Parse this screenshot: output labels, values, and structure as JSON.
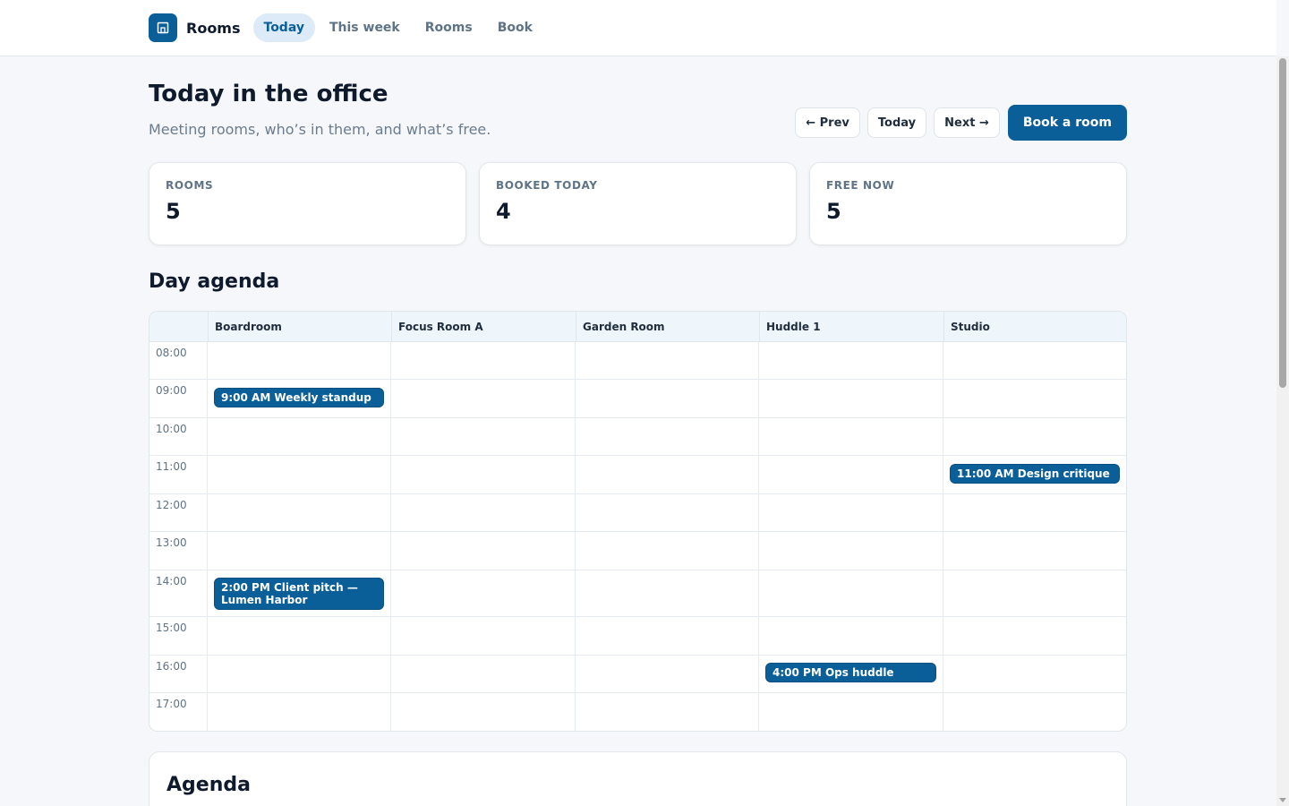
{
  "nav": {
    "brand": "Rooms",
    "items": [
      {
        "label": "Today",
        "active": true
      },
      {
        "label": "This week",
        "active": false
      },
      {
        "label": "Rooms",
        "active": false
      },
      {
        "label": "Book",
        "active": false
      }
    ]
  },
  "header": {
    "title": "Today in the office",
    "subtitle": "Meeting rooms, who’s in them, and what’s free.",
    "prev_label": "← Prev",
    "today_label": "Today",
    "next_label": "Next →",
    "book_label": "Book a room"
  },
  "stats": [
    {
      "label": "ROOMS",
      "value": "5"
    },
    {
      "label": "BOOKED TODAY",
      "value": "4"
    },
    {
      "label": "FREE NOW",
      "value": "5"
    }
  ],
  "day_agenda": {
    "title": "Day agenda",
    "rooms": [
      "Boardroom",
      "Focus Room A",
      "Garden Room",
      "Huddle 1",
      "Studio"
    ],
    "times": [
      "08:00",
      "09:00",
      "10:00",
      "11:00",
      "12:00",
      "13:00",
      "14:00",
      "15:00",
      "16:00",
      "17:00"
    ],
    "events": [
      {
        "room": "Boardroom",
        "time": "09:00",
        "label": "9:00 AM Weekly standup"
      },
      {
        "room": "Studio",
        "time": "11:00",
        "label": "11:00 AM Design critique"
      },
      {
        "room": "Boardroom",
        "time": "14:00",
        "label": "2:00 PM Client pitch — Lumen Harbor"
      },
      {
        "room": "Huddle 1",
        "time": "16:00",
        "label": "4:00 PM Ops huddle"
      }
    ]
  },
  "agenda_card": {
    "title": "Agenda"
  },
  "colors": {
    "accent": "#0b5f99",
    "accent_soft": "#dcebf7",
    "background": "#f5f7fa"
  }
}
